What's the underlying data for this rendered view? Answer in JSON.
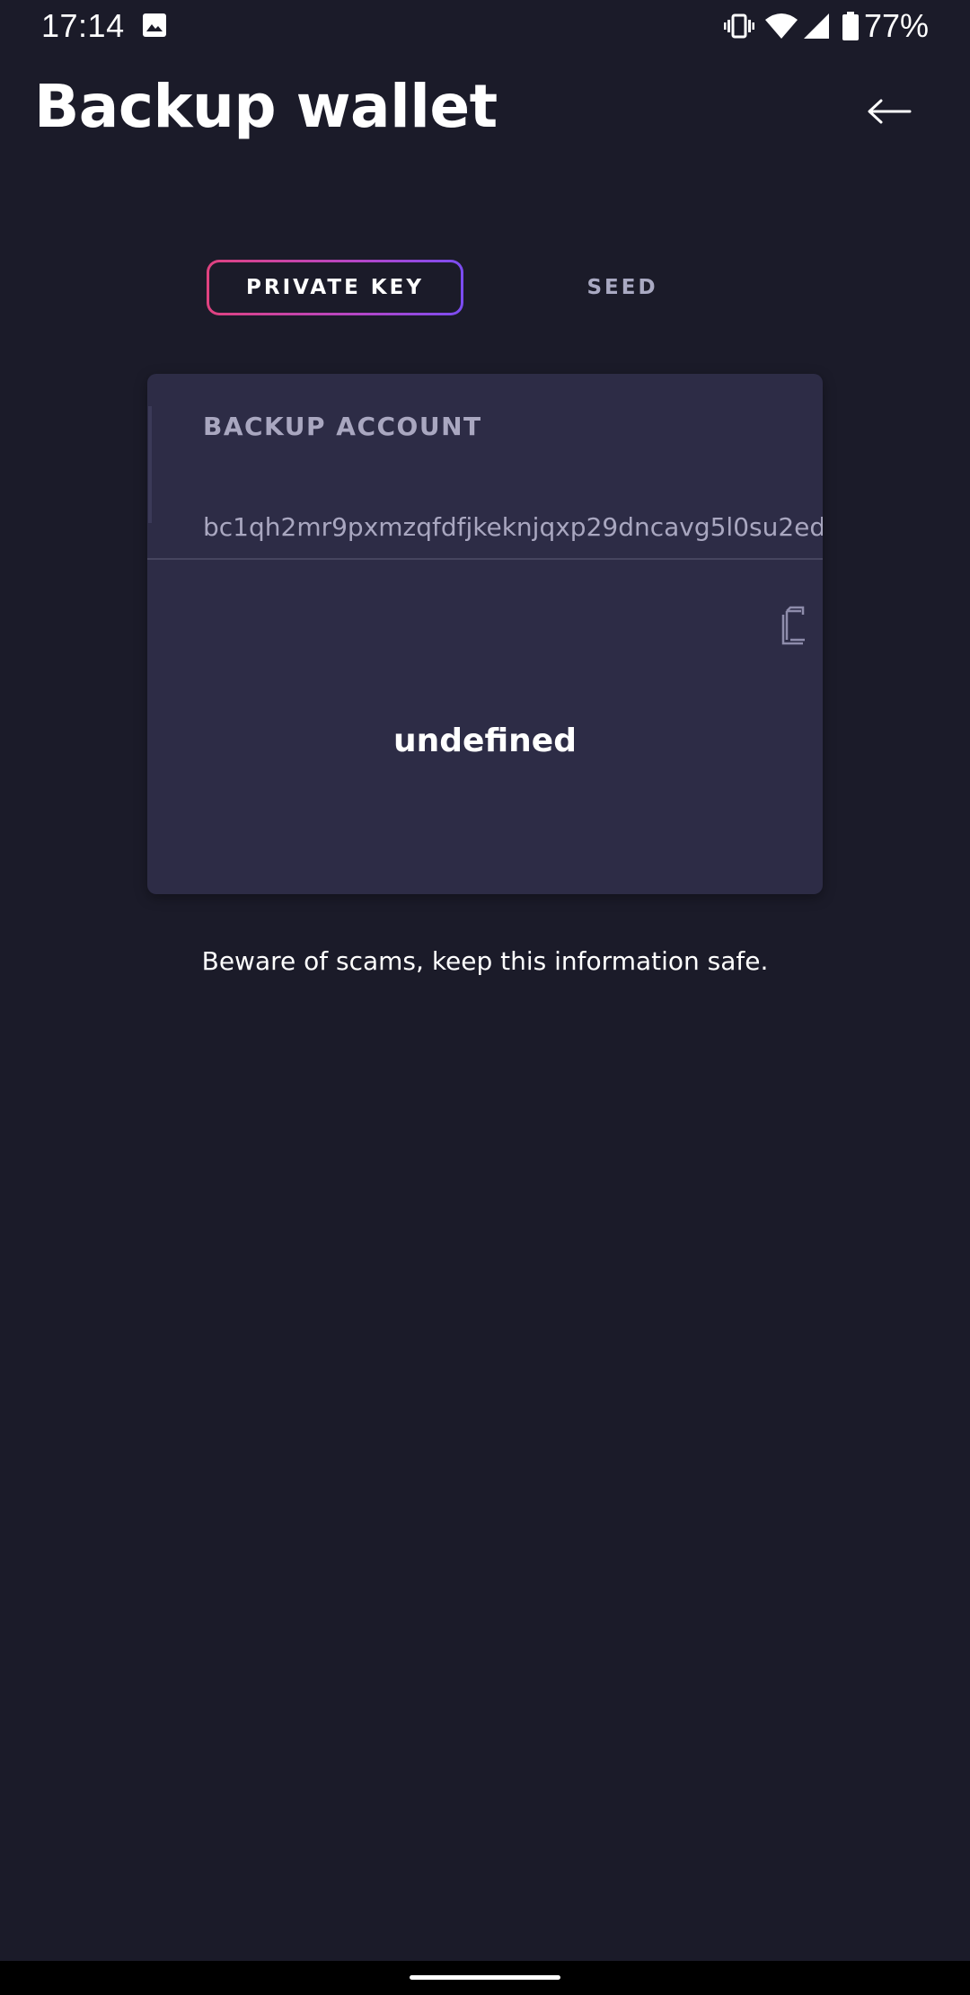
{
  "status_bar": {
    "time": "17:14",
    "battery_percent": "77%",
    "icons": [
      "image-icon",
      "vibrate-icon",
      "wifi-icon",
      "cellular-signal-icon",
      "battery-icon"
    ]
  },
  "header": {
    "title": "Backup wallet",
    "back_icon": "arrow-left-icon"
  },
  "tabs": [
    {
      "label": "PRIVATE KEY",
      "selected": true
    },
    {
      "label": "SEED",
      "selected": false
    }
  ],
  "card": {
    "label": "BACKUP ACCOUNT",
    "address": "bc1qh2mr9pxmzqfdfjkeknjqxp29dncavg5l0su2ed",
    "copy_icon": "copy-icon",
    "value": "undefined"
  },
  "warning": "Beware of scams, keep this information safe.",
  "colors": {
    "background": "#1b1b29",
    "card": "#2d2c46",
    "accent_gradient_start": "#e0427f",
    "accent_gradient_end": "#7b4cf2",
    "muted_text": "#a9a7c0"
  }
}
